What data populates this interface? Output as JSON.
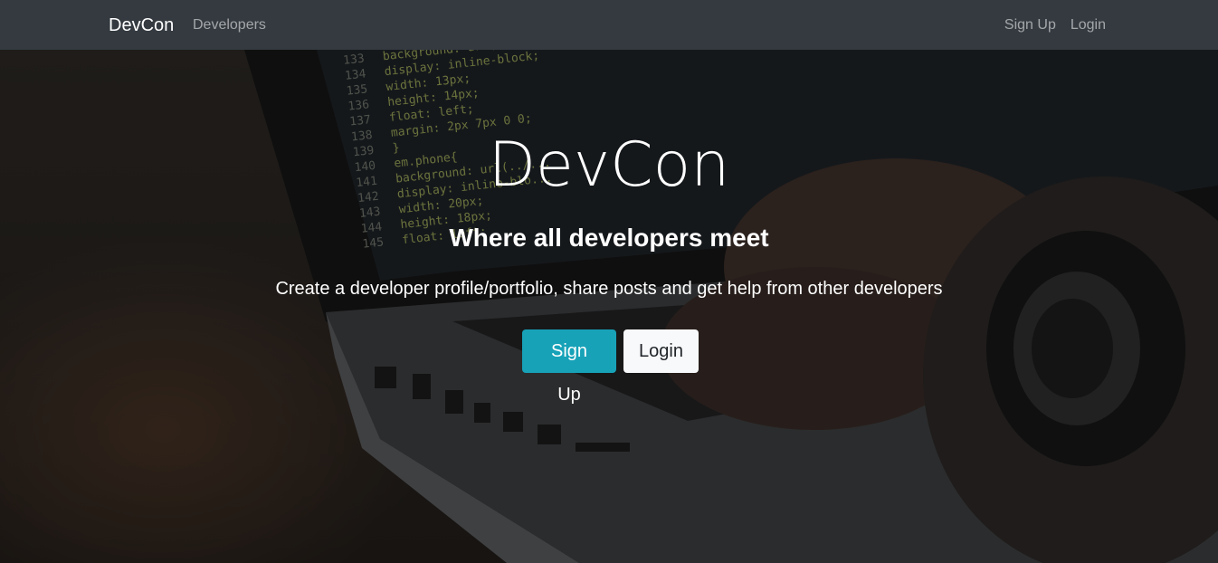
{
  "nav": {
    "brand": "DevCon",
    "left_link": "Developers",
    "right_links": [
      "Sign Up",
      "Login"
    ]
  },
  "hero": {
    "title": "DevCon",
    "subtitle": "Where all developers meet",
    "lead": "Create a developer profile/portfolio, share posts and get help from other developers",
    "buttons": {
      "signup": "Sign Up",
      "login": "Login"
    }
  },
  "code_lines": {
    "numbers": [
      "133",
      "134",
      "135",
      "136",
      "137",
      "138",
      "139",
      "140",
      "141",
      "142",
      "143",
      "144",
      "145"
    ],
    "text": [
      "background: url(...",
      "display: inline-block;",
      "width: 13px;",
      "height: 14px;",
      "float: left;",
      "margin: 2px 7px 0 0;",
      "}",
      "em.phone{",
      "background: url(../...",
      "display: inline-blo...",
      "width: 20px;",
      "height: 18px;",
      "float: left;"
    ]
  },
  "colors": {
    "navbar": "#343a40",
    "primary": "#17a2b8",
    "light": "#f8f9fa"
  }
}
